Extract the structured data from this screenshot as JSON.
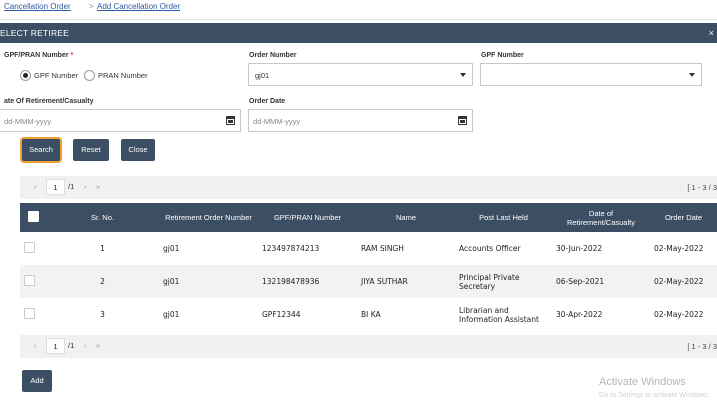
{
  "breadcrumb": {
    "item1": "Cancellation Order",
    "separator": ">",
    "item2": "Add Cancellation Order"
  },
  "section": {
    "title": "ELECT RETIREE",
    "close": "×"
  },
  "form": {
    "gpf_pran_label": "GPF/PRAN Number",
    "required_mark": "*",
    "radio_gpf": "GPF Number",
    "radio_pran": "PRAN Number",
    "order_number_label": "Order Number",
    "order_number_value": "gj01",
    "gpf_number_label": "GPF Number",
    "gpf_number_value": "",
    "retirement_date_label": "ate Of Retirement/Casualty",
    "retirement_date_placeholder": "dd-MMM-yyyy",
    "order_date_label": "Order Date",
    "order_date_placeholder": "dd-MMM-yyyy"
  },
  "buttons": {
    "search": "Search",
    "reset": "Reset",
    "close": "Close",
    "add": "Add"
  },
  "pager": {
    "first": "«",
    "prev": "‹",
    "current": "1",
    "total": "/1",
    "next": "›",
    "last": "»",
    "range": "[ 1 - 3 / 3"
  },
  "table": {
    "headers": [
      "Sr. No.",
      "Retirement Order Number",
      "GPF/PRAN Number",
      "Name",
      "Post Last Held",
      "Date of Retirement/Casualty",
      "Order Date"
    ],
    "rows": [
      [
        "1",
        "gj01",
        "123497874213",
        "RAM SINGH",
        "Accounts Officer",
        "30-Jun-2022",
        "02-May-2022"
      ],
      [
        "2",
        "gj01",
        "132198478936",
        "JIYA SUTHAR",
        "Principal Private Secretary",
        "06-Sep-2021",
        "02-May-2022"
      ],
      [
        "3",
        "gj01",
        "GPF12344",
        "BI KA",
        "Librarian and Information Assistant",
        "30-Apr-2022",
        "02-May-2022"
      ]
    ]
  },
  "watermark": {
    "line1": "Activate Windows",
    "line2": "Go to Settings to activate Windows."
  }
}
